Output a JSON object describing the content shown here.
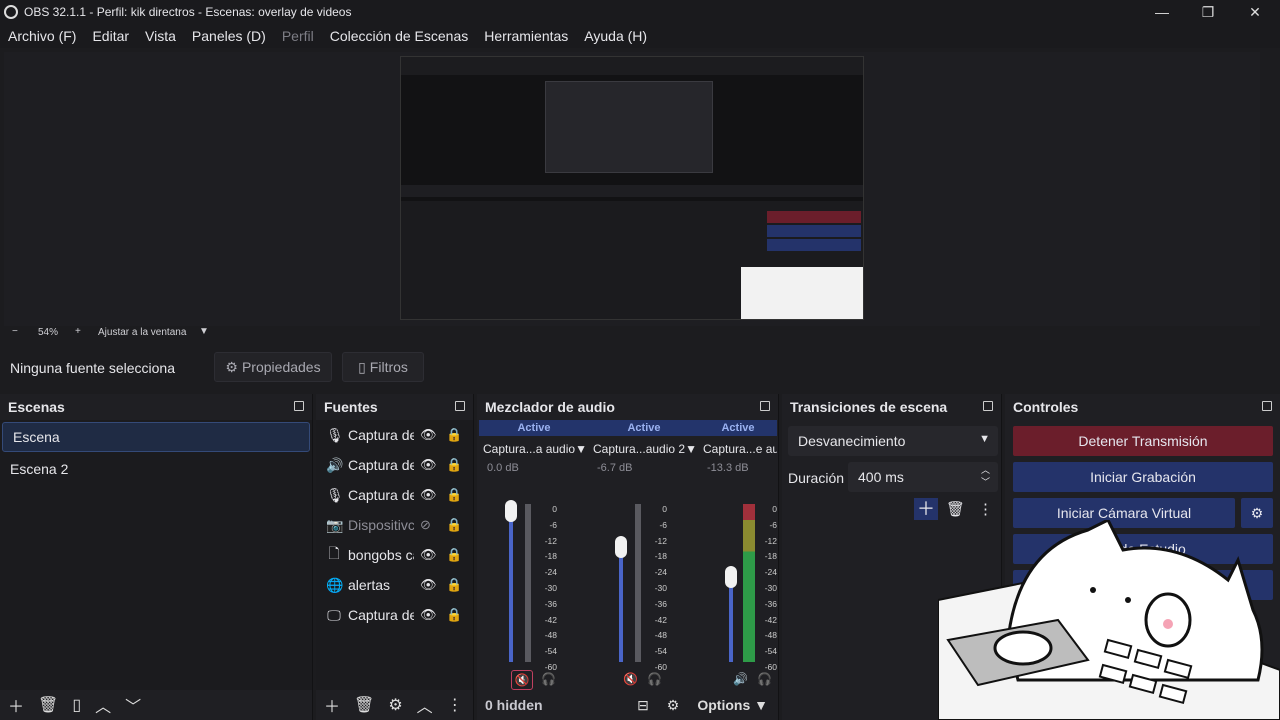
{
  "window": {
    "title": "OBS 32.1.1 - Perfil: kik directros - Escenas: overlay de videos"
  },
  "menu": [
    "Archivo (F)",
    "Editar",
    "Vista",
    "Paneles (D)",
    "Perfil",
    "Colección de Escenas",
    "Herramientas",
    "Ayuda (H)"
  ],
  "zoom": {
    "minus": "−",
    "value": "54%",
    "plus": "+",
    "fit": "Ajustar a la ventana"
  },
  "source_bar": {
    "status": "Ninguna fuente selecciona",
    "properties": "Propiedades",
    "filters": "Filtros"
  },
  "scenes": {
    "title": "Escenas",
    "items": [
      "Escena",
      "Escena 2"
    ]
  },
  "sources": {
    "title": "Fuentes",
    "items": [
      {
        "label": "Captura de",
        "icon": "mic-icon",
        "visible": true
      },
      {
        "label": "Captura de",
        "icon": "speaker-icon",
        "visible": true
      },
      {
        "label": "Captura de",
        "icon": "mic-icon",
        "visible": true
      },
      {
        "label": "Dispositivc",
        "icon": "camera-icon",
        "visible": false
      },
      {
        "label": "bongobs ca",
        "icon": "file-icon",
        "visible": true
      },
      {
        "label": "alertas",
        "icon": "globe-icon",
        "visible": true
      },
      {
        "label": "Captura de",
        "icon": "monitor-icon",
        "visible": true
      }
    ]
  },
  "mixer": {
    "title": "Mezclador de audio",
    "hidden": "0 hidden",
    "options": "Options",
    "channels": [
      {
        "active": "Active",
        "name": "Captura...a audio",
        "db": "0.0 dB",
        "level": 0.96,
        "muted": true
      },
      {
        "active": "Active",
        "name": "Captura...audio 2",
        "db": "-6.7 dB",
        "level": 0.76,
        "muted": true
      },
      {
        "active": "Active",
        "name": "Captura...e audio",
        "db": "-13.3 dB",
        "level": 0.57,
        "muted": false
      }
    ],
    "ticks": [
      "0",
      "-6",
      "-12",
      "-18",
      "-24",
      "-30",
      "-36",
      "-42",
      "-48",
      "-54",
      "-60"
    ]
  },
  "transitions": {
    "title": "Transiciones de escena",
    "type": "Desvanecimiento",
    "duration_label": "Duración",
    "duration": "400 ms"
  },
  "controls": {
    "title": "Controles",
    "stop_stream": "Detener Transmisión",
    "start_record": "Iniciar Grabación",
    "start_vcam": "Iniciar Cámara Virtual",
    "studio": "Modo Estudio",
    "colors": {
      "stop": "#6b1e2b",
      "primary": "#24336a"
    }
  }
}
